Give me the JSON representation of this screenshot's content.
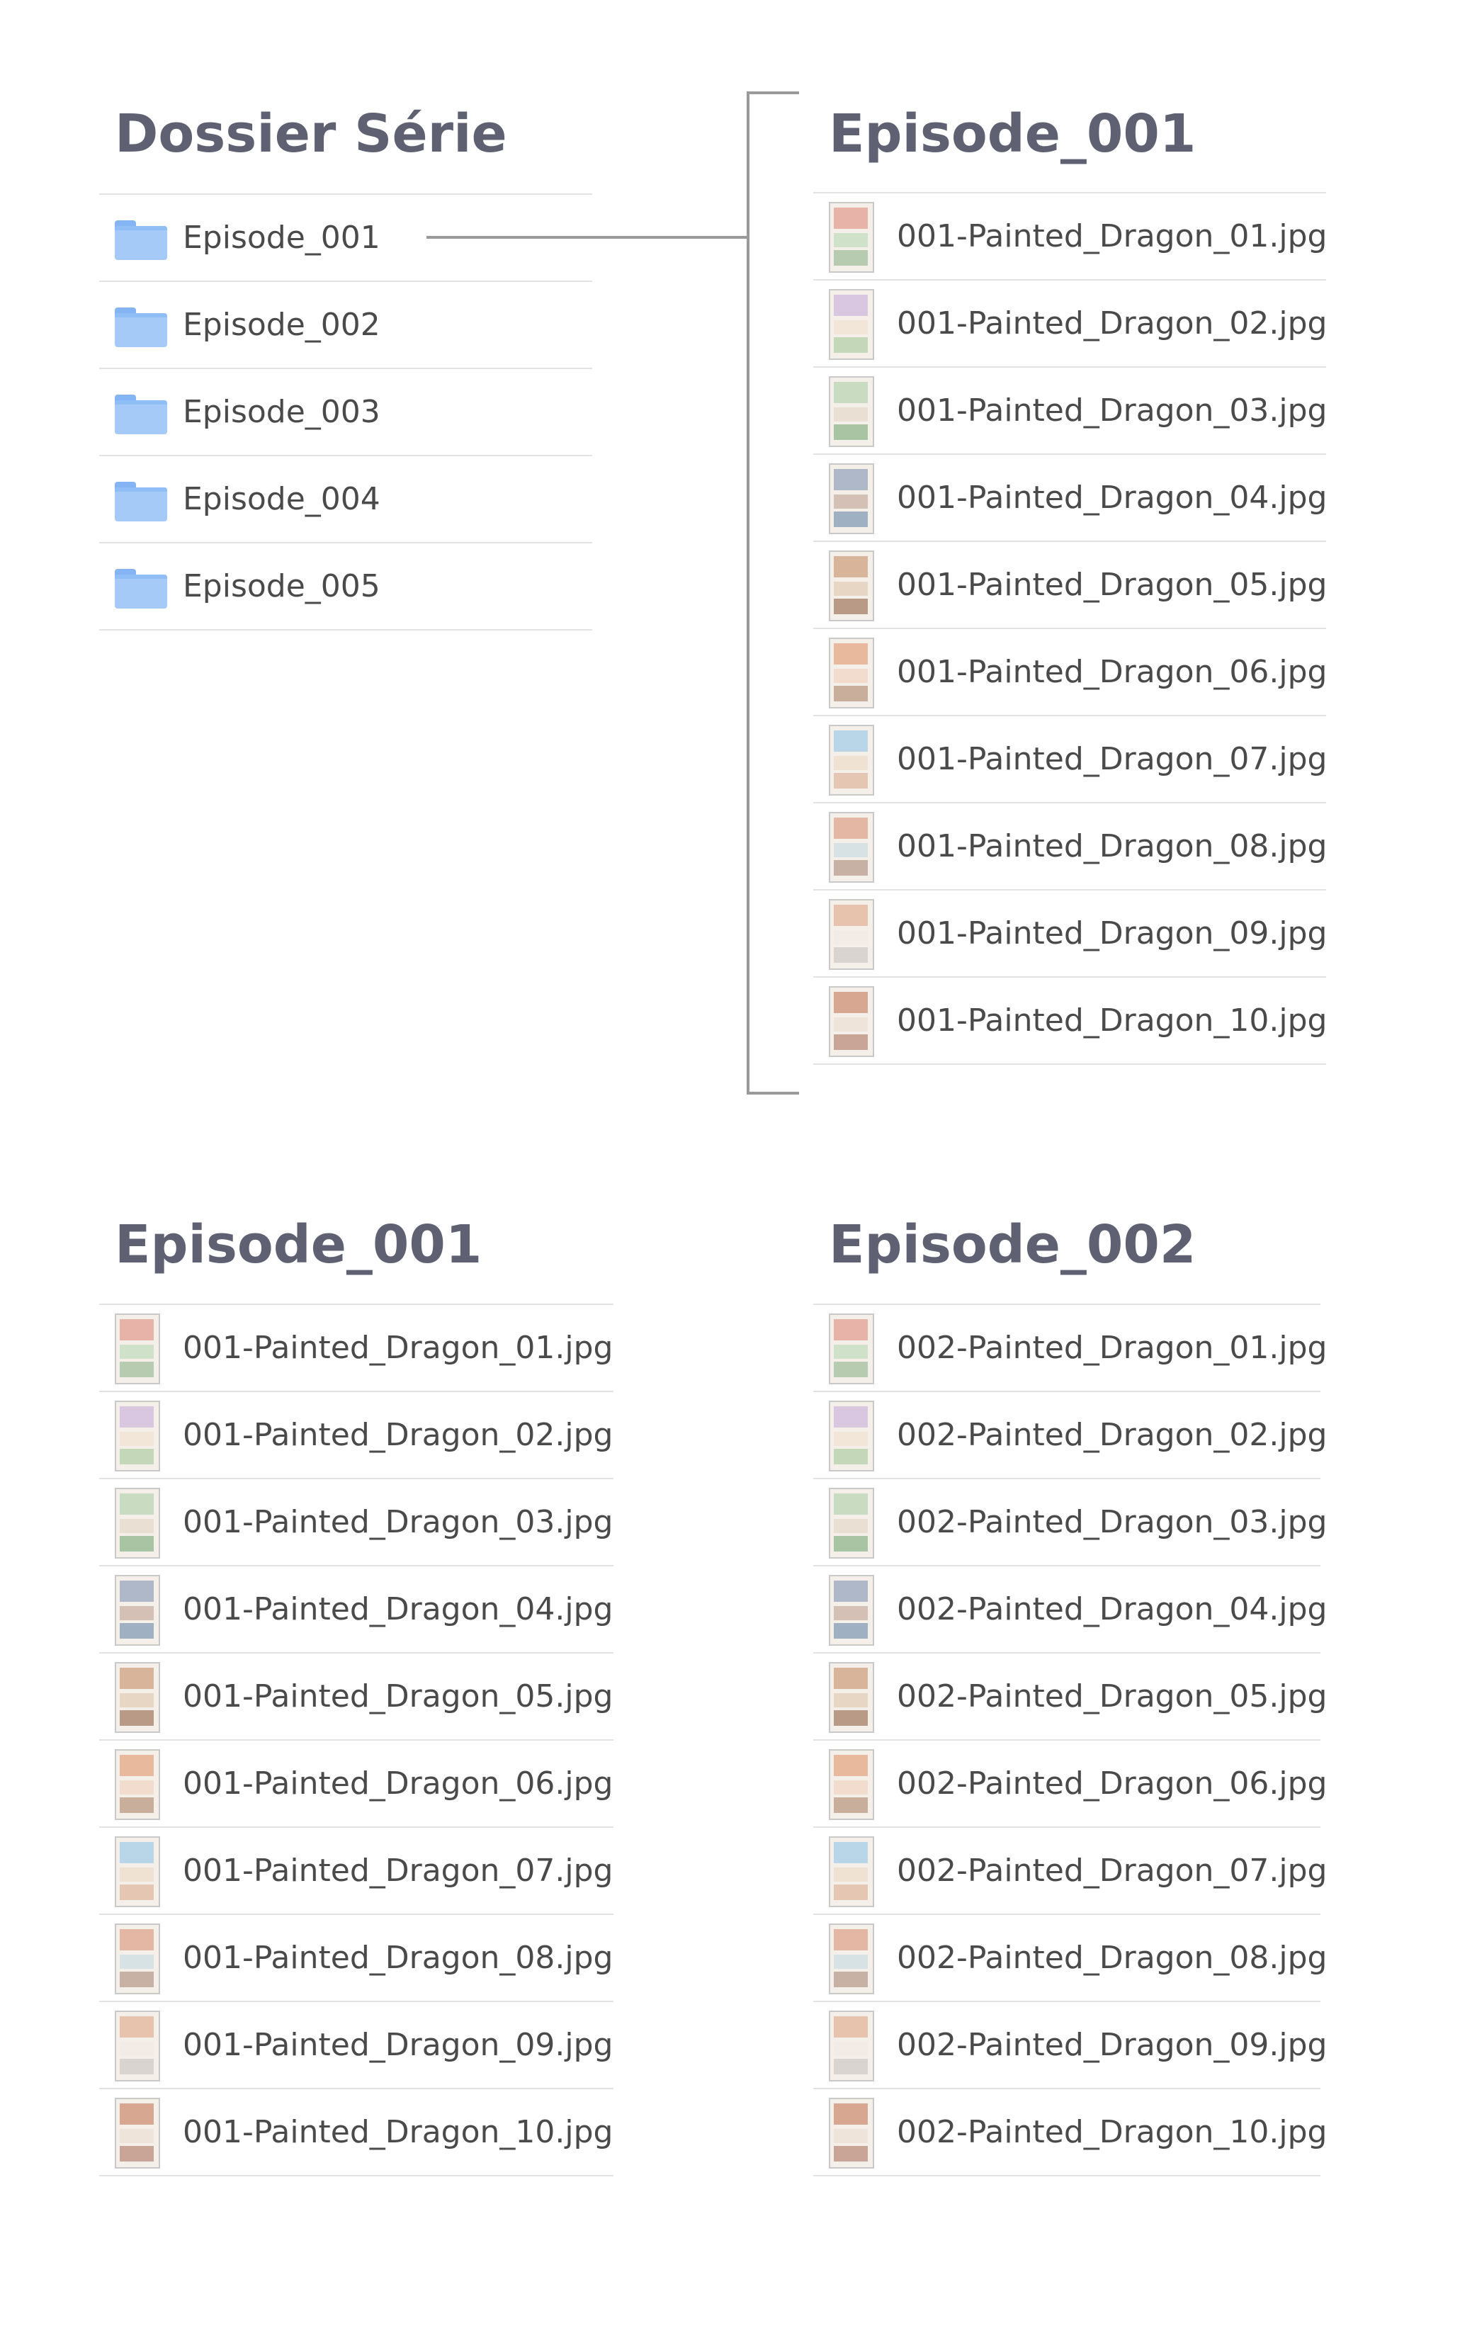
{
  "series_folder": {
    "title": "Dossier Série",
    "folders": [
      "Episode_001",
      "Episode_002",
      "Episode_003",
      "Episode_004",
      "Episode_005"
    ]
  },
  "episode_top": {
    "title": "Episode_001",
    "files": [
      "001-Painted_Dragon_01.jpg",
      "001-Painted_Dragon_02.jpg",
      "001-Painted_Dragon_03.jpg",
      "001-Painted_Dragon_04.jpg",
      "001-Painted_Dragon_05.jpg",
      "001-Painted_Dragon_06.jpg",
      "001-Painted_Dragon_07.jpg",
      "001-Painted_Dragon_08.jpg",
      "001-Painted_Dragon_09.jpg",
      "001-Painted_Dragon_10.jpg"
    ]
  },
  "episode_bottom_left": {
    "title": "Episode_001",
    "files": [
      "001-Painted_Dragon_01.jpg",
      "001-Painted_Dragon_02.jpg",
      "001-Painted_Dragon_03.jpg",
      "001-Painted_Dragon_04.jpg",
      "001-Painted_Dragon_05.jpg",
      "001-Painted_Dragon_06.jpg",
      "001-Painted_Dragon_07.jpg",
      "001-Painted_Dragon_08.jpg",
      "001-Painted_Dragon_09.jpg",
      "001-Painted_Dragon_10.jpg"
    ]
  },
  "episode_bottom_right": {
    "title": "Episode_002",
    "files": [
      "002-Painted_Dragon_01.jpg",
      "002-Painted_Dragon_02.jpg",
      "002-Painted_Dragon_03.jpg",
      "002-Painted_Dragon_04.jpg",
      "002-Painted_Dragon_05.jpg",
      "002-Painted_Dragon_06.jpg",
      "002-Painted_Dragon_07.jpg",
      "002-Painted_Dragon_08.jpg",
      "002-Painted_Dragon_09.jpg",
      "002-Painted_Dragon_10.jpg"
    ]
  },
  "icons": {
    "folder": "folder-icon",
    "file": "image-thumbnail-icon"
  },
  "colors": {
    "title": "#5f6173",
    "text": "#4a4a4a",
    "folder": "#a5caf7",
    "divider": "#e2e2e2",
    "connector": "#9a9a9a"
  }
}
